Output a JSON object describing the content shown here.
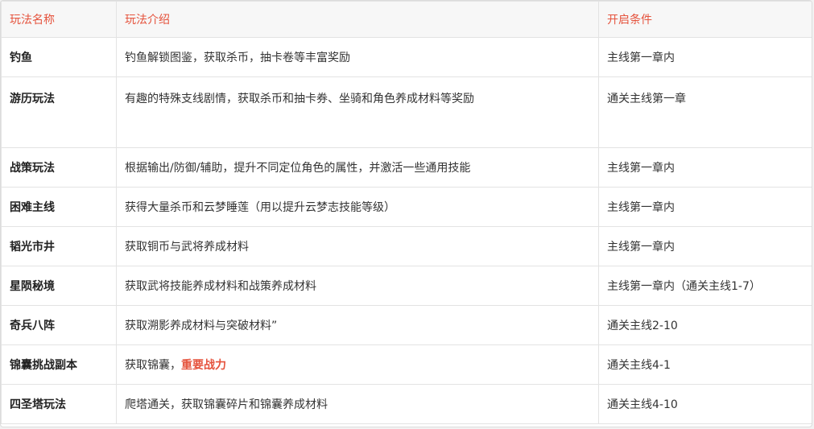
{
  "header": {
    "col1": "玩法名称",
    "col2": "玩法介绍",
    "col3": "开启条件"
  },
  "rows": [
    {
      "name": "钓鱼",
      "desc": "钓鱼解锁图鉴，获取杀币，抽卡卷等丰富奖励",
      "cond": "主线第一章内"
    },
    {
      "name": "游历玩法",
      "desc": "有趣的特殊支线剧情，获取杀币和抽卡券、坐骑和角色养成材料等奖励",
      "cond": "通关主线第一章"
    },
    {
      "name": "战策玩法",
      "desc": "根据输出/防御/辅助，提升不同定位角色的属性，并激活一些通用技能",
      "cond": "主线第一章内"
    },
    {
      "name": "困难主线",
      "desc": "获得大量杀币和云梦睡莲（用以提升云梦志技能等级）",
      "cond": "主线第一章内"
    },
    {
      "name": "韬光市井",
      "desc": "获取铜币与武将养成材料",
      "cond": "主线第一章内"
    },
    {
      "name": "星陨秘境",
      "desc": "获取武将技能养成材料和战策养成材料",
      "cond": "主线第一章内（通关主线1-7）"
    },
    {
      "name": "奇兵八阵",
      "desc": "获取溯影养成材料与突破材料”",
      "cond": "通关主线2-10"
    },
    {
      "name": "锦囊挑战副本",
      "desc_prefix": "获取锦囊，",
      "desc_highlight": "重要战力",
      "cond": "通关主线4-1"
    },
    {
      "name": "四圣塔玩法",
      "desc": "爬塔通关，获取锦囊碎片和锦囊养成材料",
      "cond": "通关主线4-10"
    }
  ],
  "colors": {
    "header_text": "#e5533d",
    "highlight": "#e5533d"
  }
}
